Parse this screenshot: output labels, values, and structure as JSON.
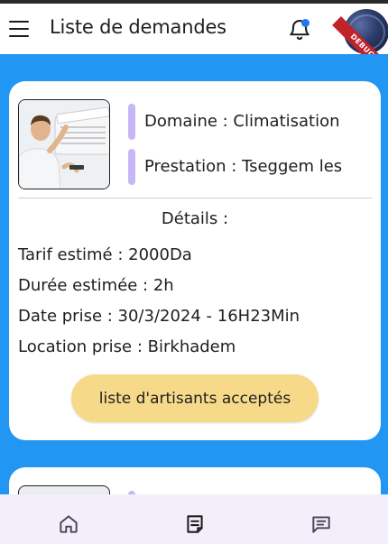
{
  "app_bar": {
    "title": "Liste de demandes",
    "menu_icon": "hamburger-menu-icon",
    "notification_icon": "bell-icon",
    "notification_dot_color": "#1e78ee",
    "debug_banner": "DEBUG"
  },
  "colors": {
    "background": "#2196f3",
    "card": "#ffffff",
    "accent_bar": "#c7b8f5",
    "primary_button": "#f7d98a",
    "bottom_nav": "#f3effa"
  },
  "request_card": {
    "domain": "Domaine : Climatisation",
    "service": "Prestation : Tseggem les",
    "details_title": "Détails :",
    "tariff": "Tarif estimé : 2000Da",
    "duration": "Durée estimée : 2h",
    "date": "Date prise : 30/3/2024 - 16H23Min",
    "location": "Location prise : Birkhadem",
    "action_label": "liste d'artisants acceptés"
  },
  "bottom_nav": {
    "items": [
      {
        "icon": "home-icon"
      },
      {
        "icon": "requests-icon",
        "active": true
      },
      {
        "icon": "chat-icon"
      }
    ]
  }
}
